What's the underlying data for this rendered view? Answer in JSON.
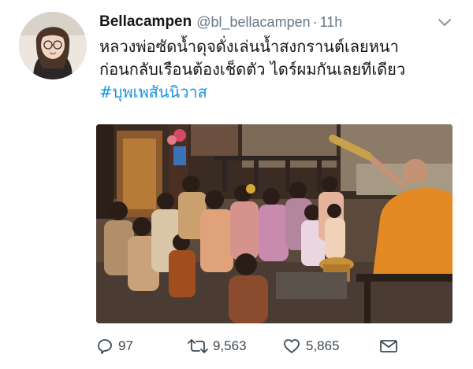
{
  "tweet": {
    "display_name": "Bellacampen",
    "handle": "@bl_bellacampen",
    "separator": "·",
    "time": "11h",
    "text_lines": [
      "หลวงพ่อซัดน้ำดุจดั่งเล่นน้ำสงกรานต์เลยหนา",
      "ก่อนกลับเรือนต้องเช็ดตัว ไดร์ผมกันเลยทีเดียว"
    ],
    "hashtag": "#บุพเพสันนิวาส"
  },
  "actions": {
    "replies": "97",
    "retweets": "9,563",
    "likes": "5,865"
  },
  "icons": [
    "chevron-down-icon",
    "reply-icon",
    "retweet-icon",
    "like-icon",
    "message-icon"
  ],
  "colors": {
    "link": "#1b95e0",
    "secondary": "#657786",
    "robe": "#e38a25"
  }
}
